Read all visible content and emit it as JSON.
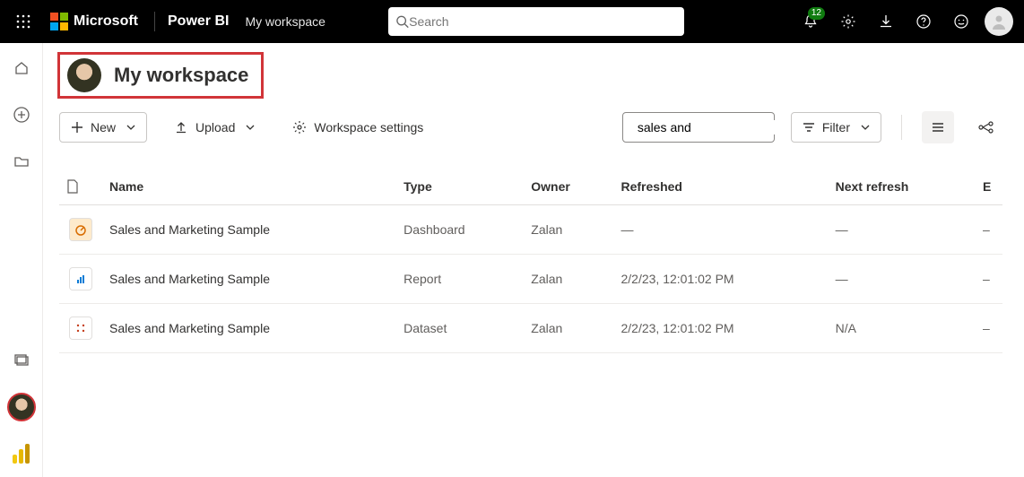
{
  "header": {
    "microsoft": "Microsoft",
    "product": "Power BI",
    "workspace_breadcrumb": "My workspace",
    "search_placeholder": "Search",
    "notification_count": "12"
  },
  "workspace": {
    "title": "My workspace"
  },
  "toolbar": {
    "new_label": "New",
    "upload_label": "Upload",
    "settings_label": "Workspace settings",
    "search_value": "sales and",
    "filter_label": "Filter"
  },
  "columns": {
    "icon": "",
    "name": "Name",
    "type": "Type",
    "owner": "Owner",
    "refreshed": "Refreshed",
    "next_refresh": "Next refresh",
    "last": "E"
  },
  "rows": [
    {
      "name": "Sales and Marketing Sample",
      "type": "Dashboard",
      "owner": "Zalan",
      "refreshed": "—",
      "next": "—",
      "last": "–"
    },
    {
      "name": "Sales and Marketing Sample",
      "type": "Report",
      "owner": "Zalan",
      "refreshed": "2/2/23, 12:01:02 PM",
      "next": "—",
      "last": "–"
    },
    {
      "name": "Sales and Marketing Sample",
      "type": "Dataset",
      "owner": "Zalan",
      "refreshed": "2/2/23, 12:01:02 PM",
      "next": "N/A",
      "last": "–"
    }
  ]
}
